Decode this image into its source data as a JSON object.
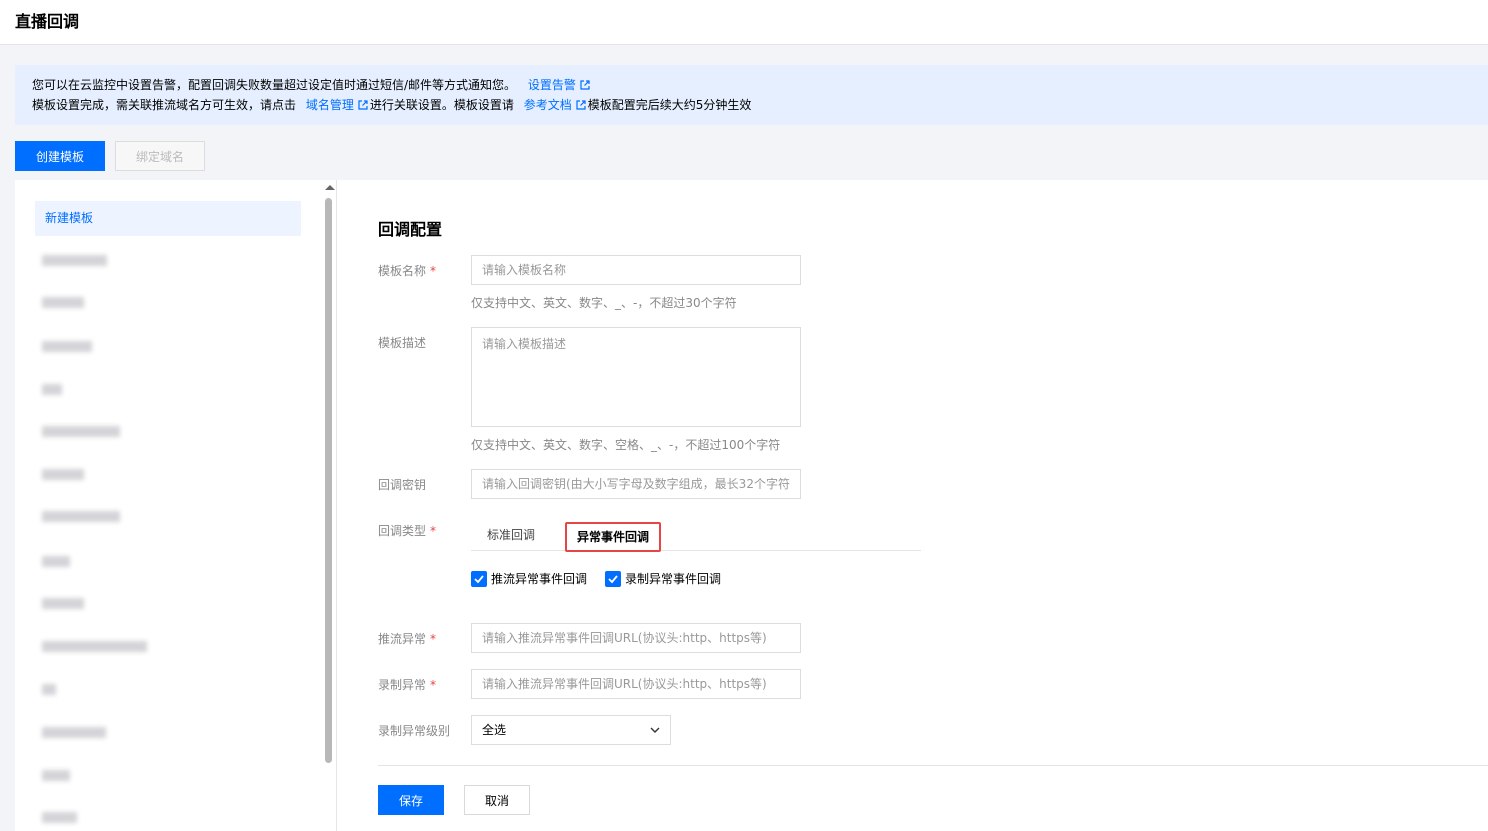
{
  "header": {
    "title": "直播回调"
  },
  "notice": {
    "line1_text": "您可以在云监控中设置告警，配置回调失败数量超过设定值时通过短信/邮件等方式通知您。",
    "line1_link": "设置告警",
    "line2_text_a": "模板设置完成，需关联推流域名方可生效，请点击",
    "line2_link_a": "域名管理",
    "line2_text_b": "进行关联设置。模板设置请",
    "line2_link_b": "参考文档",
    "line2_text_c": "模板配置完后续大约5分钟生效"
  },
  "toolbar": {
    "create_label": "创建模板",
    "bind_label": "绑定域名"
  },
  "sidebar": {
    "active_item": "新建模板"
  },
  "form": {
    "title": "回调配置",
    "name_label": "模板名称",
    "name_placeholder": "请输入模板名称",
    "name_hint": "仅支持中文、英文、数字、_、-，不超过30个字符",
    "desc_label": "模板描述",
    "desc_placeholder": "请输入模板描述",
    "desc_hint": "仅支持中文、英文、数字、空格、_、-，不超过100个字符",
    "key_label": "回调密钥",
    "key_placeholder": "请输入回调密钥(由大小写字母及数字组成，最长32个字符)",
    "type_label": "回调类型",
    "tabs": [
      "标准回调",
      "异常事件回调"
    ],
    "checkboxes": [
      "推流异常事件回调",
      "录制异常事件回调"
    ],
    "push_label": "推流异常",
    "push_placeholder": "请输入推流异常事件回调URL(协议头:http、https等)",
    "record_label": "录制异常",
    "record_placeholder": "请输入推流异常事件回调URL(协议头:http、https等)",
    "level_label": "录制异常级别",
    "level_value": "全选",
    "save_label": "保存",
    "cancel_label": "取消"
  },
  "colors": {
    "primary": "#006eff",
    "required": "#e54545",
    "notice_bg": "#e5efff"
  }
}
